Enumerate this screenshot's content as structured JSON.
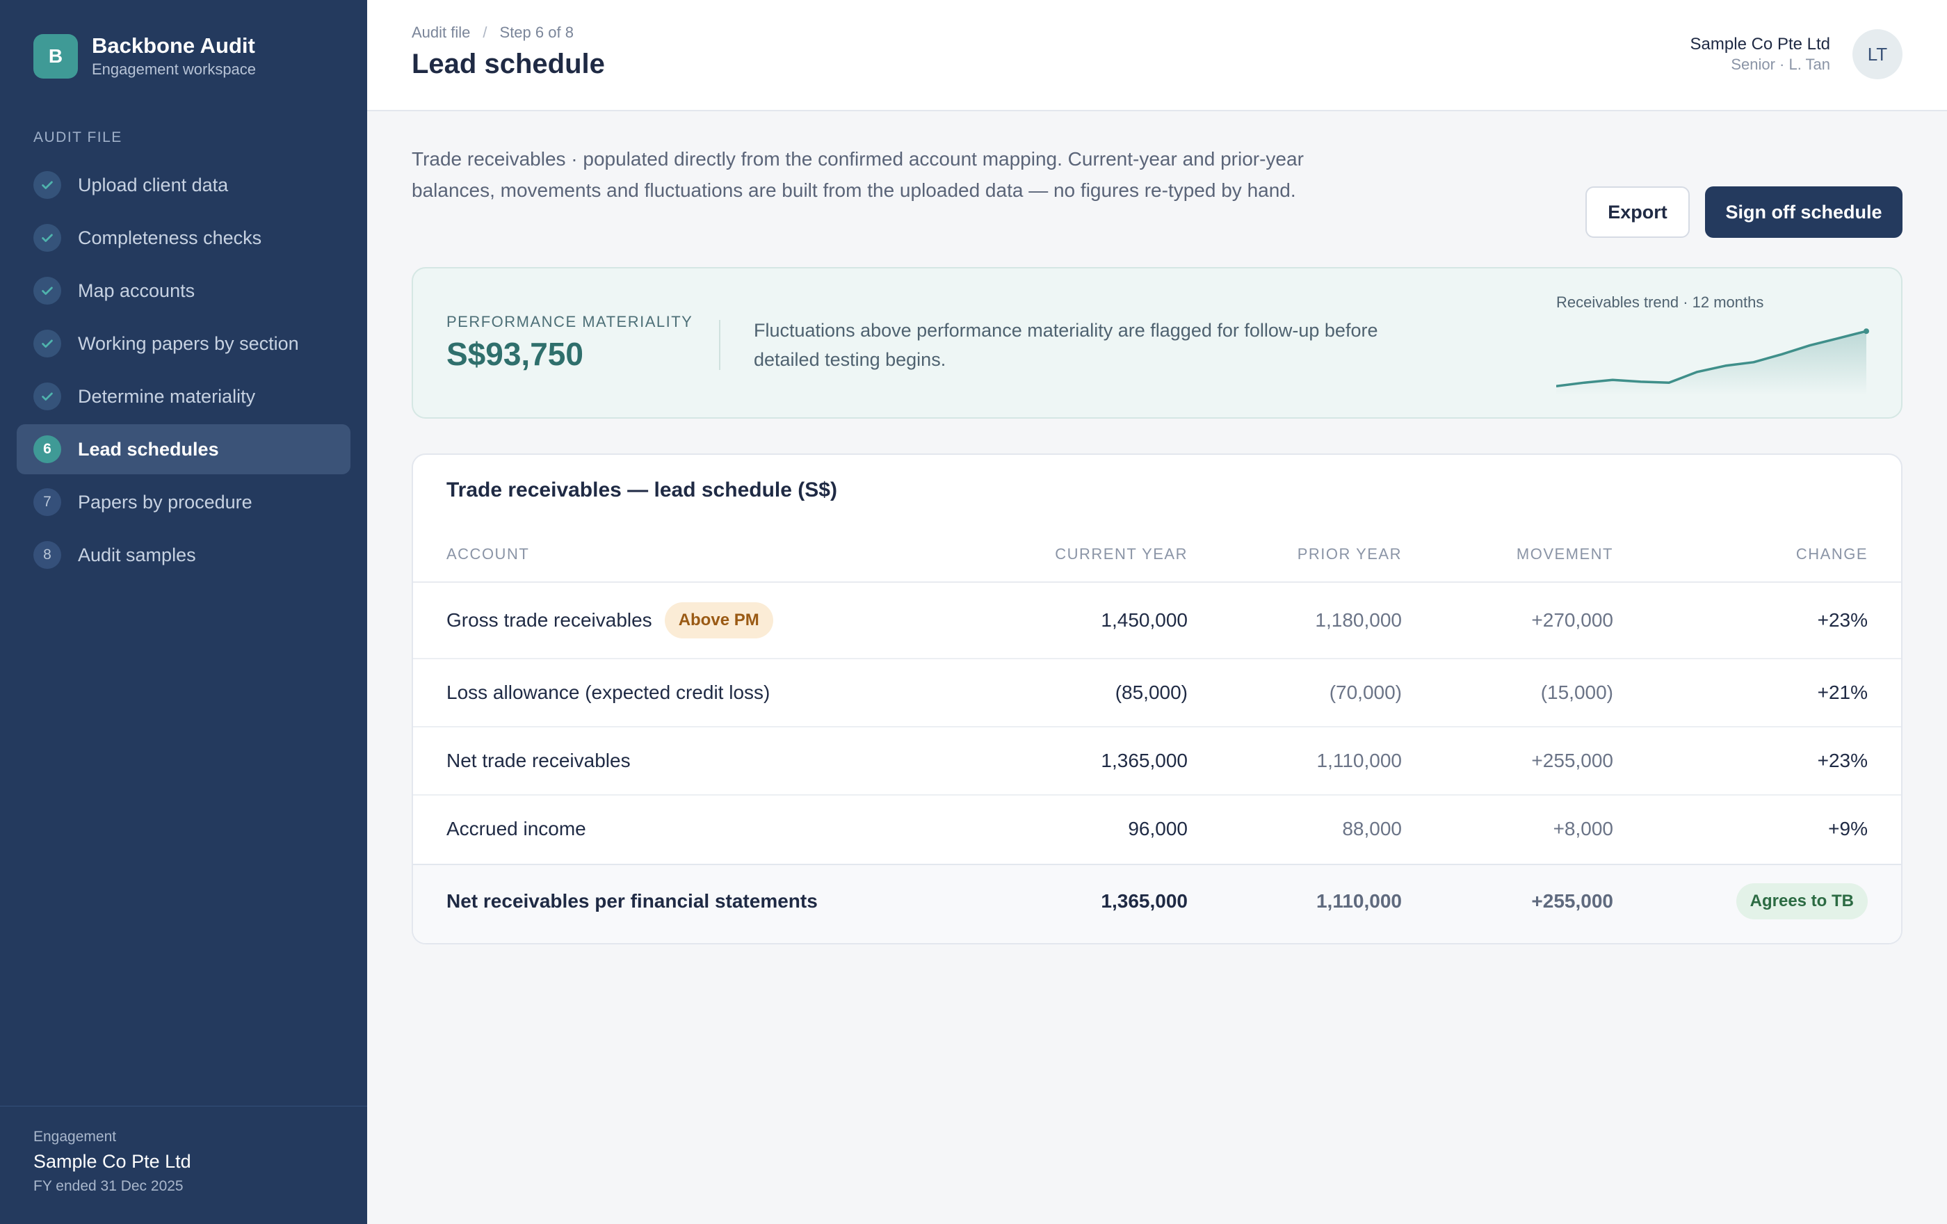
{
  "brand": {
    "logo_letter": "B",
    "name": "Backbone Audit",
    "subtitle": "Engagement workspace"
  },
  "sidebar": {
    "section_label": "AUDIT FILE",
    "items": [
      {
        "label": "Upload client data",
        "status": "done",
        "icon": "check-icon"
      },
      {
        "label": "Completeness checks",
        "status": "done",
        "icon": "check-icon"
      },
      {
        "label": "Map accounts",
        "status": "done",
        "icon": "check-icon"
      },
      {
        "label": "Working papers by section",
        "status": "done",
        "icon": "check-icon"
      },
      {
        "label": "Determine materiality",
        "status": "done",
        "icon": "check-icon"
      },
      {
        "label": "Lead schedules",
        "status": "current",
        "number": "6"
      },
      {
        "label": "Papers by procedure",
        "status": "todo",
        "number": "7"
      },
      {
        "label": "Audit samples",
        "status": "todo",
        "number": "8"
      }
    ],
    "footer": {
      "label": "Engagement",
      "client": "Sample Co Pte Ltd",
      "period": "FY ended 31 Dec 2025"
    }
  },
  "header": {
    "breadcrumb": [
      "Audit file",
      "Step 6 of 8"
    ],
    "separator": "/",
    "title": "Lead schedule",
    "user": {
      "company": "Sample Co Pte Ltd",
      "role": "Senior · L. Tan",
      "initials": "LT"
    }
  },
  "intro_text": "Trade receivables · populated directly from the confirmed account mapping. Current-year and prior-year balances, movements and fluctuations are built from the uploaded data — no figures re-typed by hand.",
  "actions": {
    "export_label": "Export",
    "signoff_label": "Sign off schedule"
  },
  "materiality": {
    "label": "PERFORMANCE MATERIALITY",
    "value": "S$93,750",
    "note": "Fluctuations above performance materiality are flagged for follow-up before detailed testing begins.",
    "trend_label": "Receivables trend · 12 months",
    "trend_color": "#3f8f8a"
  },
  "chart_data": {
    "type": "area",
    "title": "Receivables trend · 12 months",
    "x": [
      1,
      2,
      3,
      4,
      5,
      6,
      7,
      8,
      9,
      10,
      11,
      12
    ],
    "values": [
      10,
      14,
      17,
      15,
      14,
      26,
      33,
      37,
      46,
      56,
      64,
      72
    ],
    "ylim": [
      0,
      80
    ],
    "axes_visible": false,
    "grid": false
  },
  "table": {
    "title": "Trade receivables — lead schedule (S$)",
    "columns": [
      "ACCOUNT",
      "CURRENT YEAR",
      "PRIOR YEAR",
      "MOVEMENT",
      "CHANGE"
    ],
    "rows": [
      {
        "account": "Gross trade receivables",
        "flag": "Above PM",
        "current": "1,450,000",
        "prior": "1,180,000",
        "movement": "+270,000",
        "change": "+23%"
      },
      {
        "account": "Loss allowance (expected credit loss)",
        "current": "(85,000)",
        "prior": "(70,000)",
        "movement": "(15,000)",
        "change": "+21%"
      },
      {
        "account": "Net trade receivables",
        "current": "1,365,000",
        "prior": "1,110,000",
        "movement": "+255,000",
        "change": "+23%"
      },
      {
        "account": "Accrued income",
        "current": "96,000",
        "prior": "88,000",
        "movement": "+8,000",
        "change": "+9%"
      }
    ],
    "total": {
      "account": "Net receivables per financial statements",
      "current": "1,365,000",
      "prior": "1,110,000",
      "movement": "+255,000",
      "status": "Agrees to TB"
    }
  },
  "colors": {
    "sidebar_bg": "#243a5e",
    "accent_teal": "#3f9a96",
    "primary_button": "#243a5e",
    "flag_bg": "#fbecd6",
    "agree_bg": "#e3f2e8"
  }
}
